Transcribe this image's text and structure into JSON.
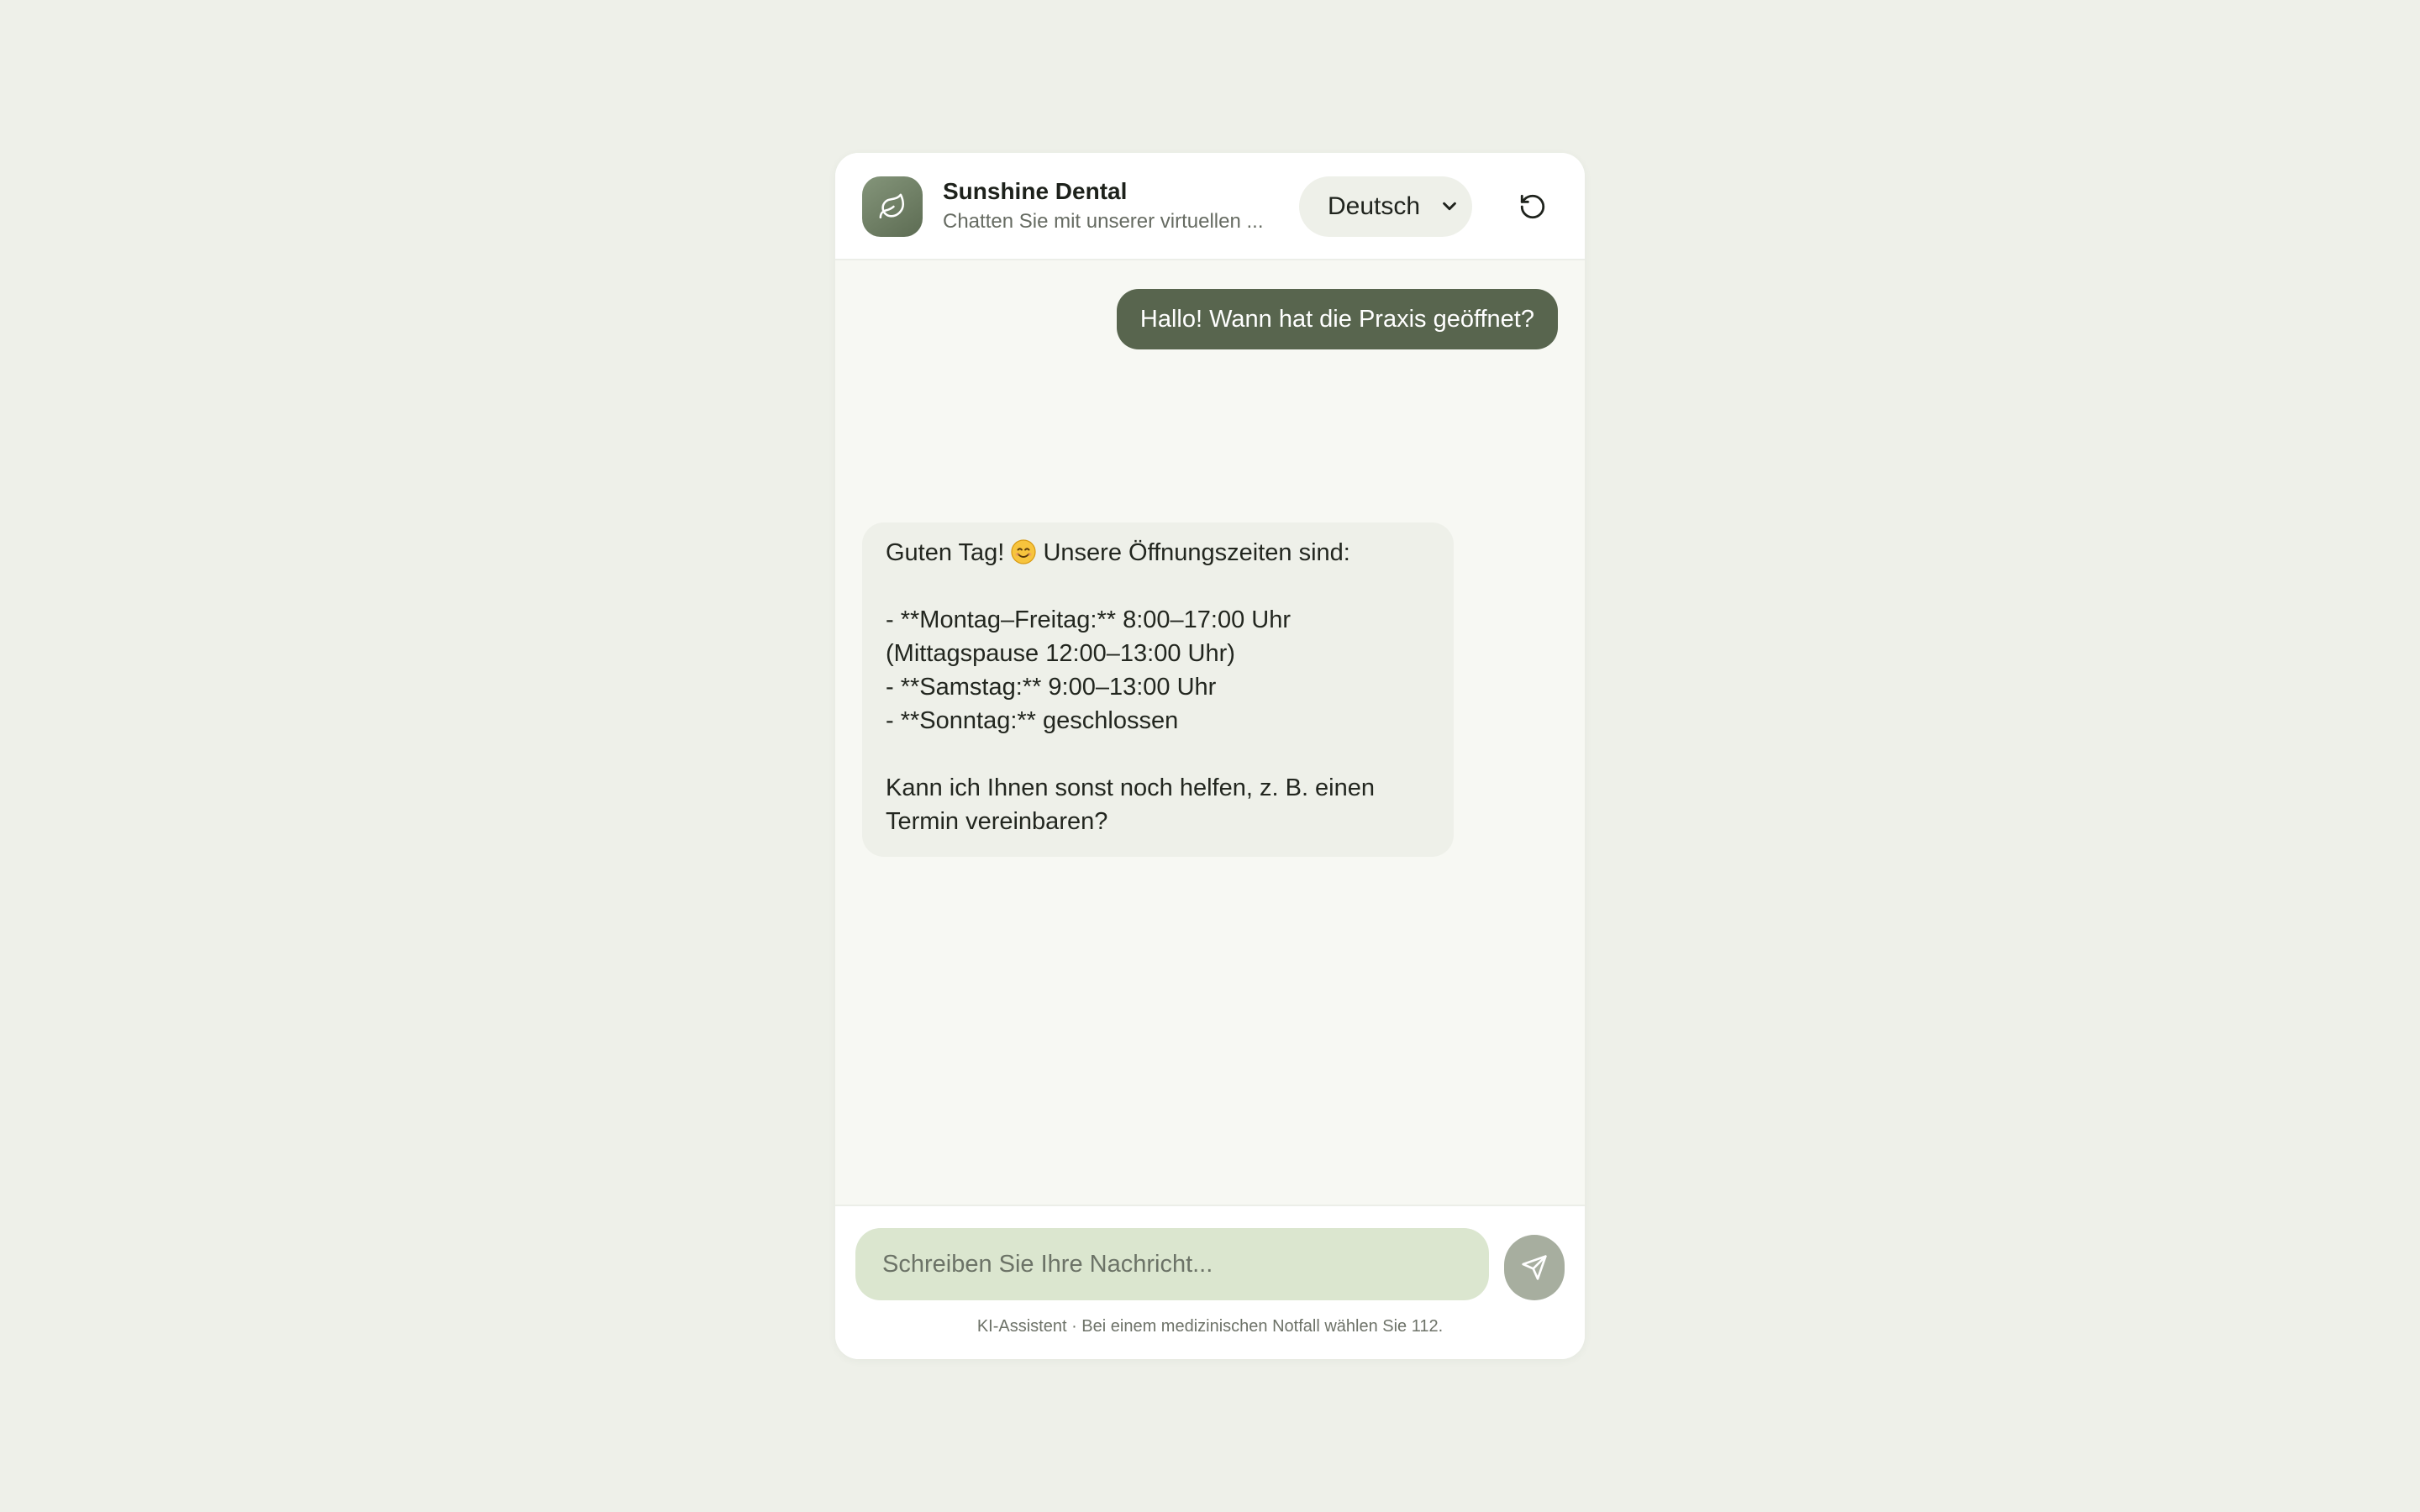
{
  "header": {
    "title": "Sunshine Dental",
    "subtitle": "Chatten Sie mit unserer virtuellen ...",
    "language": "Deutsch",
    "avatar_icon": "leaf-icon",
    "reset_icon": "refresh-icon"
  },
  "messages": {
    "user": [
      {
        "text": "Hallo! Wann hat die Praxis geöffnet?"
      }
    ],
    "bot": {
      "greeting_before_emoji": "Guten Tag! ",
      "emoji": "smiling-face-emoji",
      "greeting_after_emoji": " Unsere Öffnungszeiten sind:",
      "lines": [
        "- **Montag–Freitag:** 8:00–17:00 Uhr (Mittagspause 12:00–13:00 Uhr)",
        "- **Samstag:** 9:00–13:00 Uhr",
        "- **Sonntag:** geschlossen"
      ],
      "closing": "Kann ich Ihnen sonst noch helfen, z. B. einen Termin vereinbaren?"
    }
  },
  "composer": {
    "placeholder": "Schreiben Sie Ihre Nachricht...",
    "value": "",
    "send_icon": "send-icon"
  },
  "footer": {
    "disclaimer": "KI-Assistent · Bei einem medizinischen Notfall wählen Sie 112."
  },
  "colors": {
    "page_background": "#eef0e9",
    "accent": "#58654e",
    "input_background": "#dbe6cf",
    "bot_bubble": "#eef0e9"
  }
}
